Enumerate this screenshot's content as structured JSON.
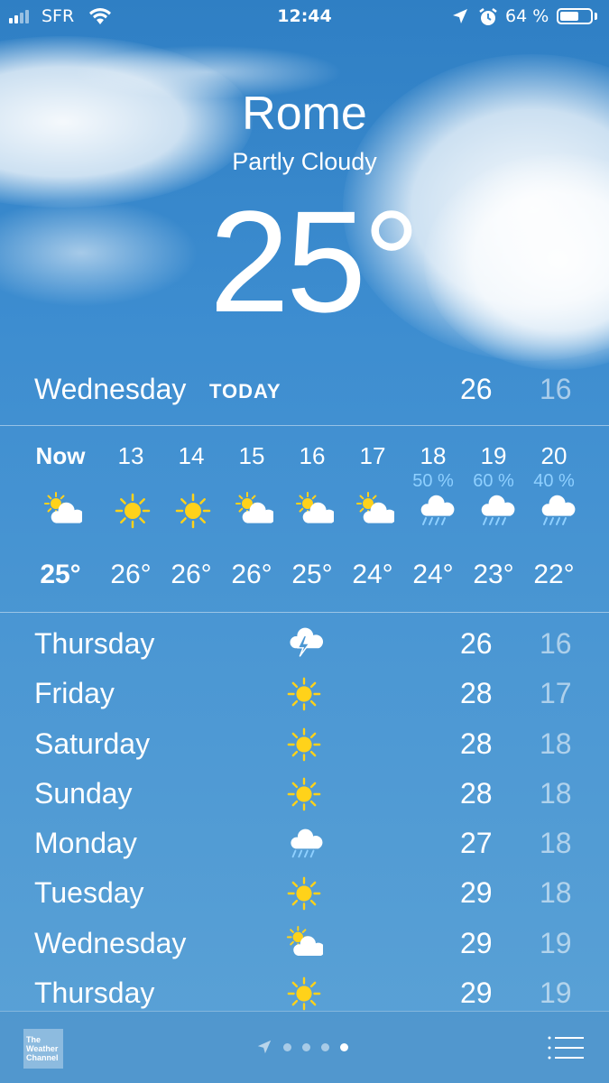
{
  "status_bar": {
    "carrier": "SFR",
    "time": "12:44",
    "battery": "64 %",
    "battery_level": 0.64
  },
  "header": {
    "city": "Rome",
    "condition": "Partly Cloudy",
    "temperature": "25°"
  },
  "today": {
    "day": "Wednesday",
    "tag": "TODAY",
    "high": "26",
    "low": "16"
  },
  "hourly": [
    {
      "time": "Now",
      "pop": "",
      "icon": "sun-cloud",
      "temp": "25°"
    },
    {
      "time": "13",
      "pop": "",
      "icon": "sun",
      "temp": "26°"
    },
    {
      "time": "14",
      "pop": "",
      "icon": "sun",
      "temp": "26°"
    },
    {
      "time": "15",
      "pop": "",
      "icon": "sun-cloud",
      "temp": "26°"
    },
    {
      "time": "16",
      "pop": "",
      "icon": "sun-cloud",
      "temp": "25°"
    },
    {
      "time": "17",
      "pop": "",
      "icon": "sun-cloud",
      "temp": "24°"
    },
    {
      "time": "18",
      "pop": "50 %",
      "icon": "rain",
      "temp": "24°"
    },
    {
      "time": "19",
      "pop": "60 %",
      "icon": "rain",
      "temp": "23°"
    },
    {
      "time": "20",
      "pop": "40 %",
      "icon": "rain",
      "temp": "22°"
    }
  ],
  "daily": [
    {
      "day": "Thursday",
      "icon": "storm",
      "high": "26",
      "low": "16"
    },
    {
      "day": "Friday",
      "icon": "sun",
      "high": "28",
      "low": "17"
    },
    {
      "day": "Saturday",
      "icon": "sun",
      "high": "28",
      "low": "18"
    },
    {
      "day": "Sunday",
      "icon": "sun",
      "high": "28",
      "low": "18"
    },
    {
      "day": "Monday",
      "icon": "rain",
      "high": "27",
      "low": "18"
    },
    {
      "day": "Tuesday",
      "icon": "sun",
      "high": "29",
      "low": "18"
    },
    {
      "day": "Wednesday",
      "icon": "sun-cloud",
      "high": "29",
      "low": "19"
    },
    {
      "day": "Thursday",
      "icon": "sun",
      "high": "29",
      "low": "19"
    }
  ],
  "bottom_bar": {
    "logo_text": "The Weather Channel",
    "page_count": 4,
    "active_page": 4
  },
  "colors": {
    "sun": "#ffd21a",
    "precip": "#8fd0ff",
    "low_temp": "#a9cdea"
  }
}
